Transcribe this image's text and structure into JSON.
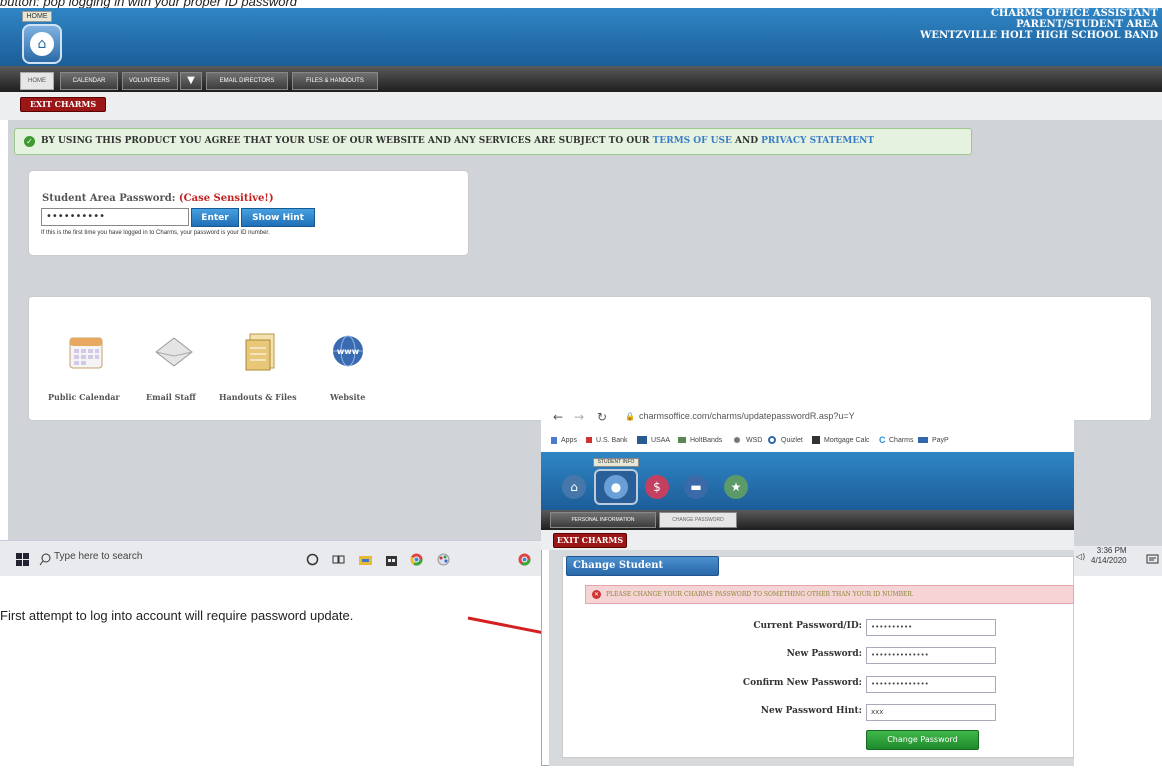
{
  "top_caption": "button: pop logging in with your proper ID password",
  "header": {
    "home_badge": "HOME",
    "right_line1": "CHARMS OFFICE ASSISTANT",
    "right_line2": "PARENT/STUDENT AREA",
    "right_line3": "WENTZVILLE HOLT HIGH SCHOOL BAND"
  },
  "nav": {
    "tabs": [
      "HOME",
      "CALENDAR",
      "VOLUNTEERS",
      "EMAIL DIRECTORS",
      "FILES & HANDOUTS"
    ]
  },
  "exit_label": "EXIT CHARMS",
  "agree": {
    "text": "BY USING THIS PRODUCT YOU AGREE THAT YOUR USE OF OUR WEBSITE AND ANY SERVICES ARE SUBJECT TO OUR",
    "link1": "TERMS OF USE",
    "and": "AND",
    "link2": "PRIVACY STATEMENT"
  },
  "login": {
    "label": "Student Area Password:",
    "case_note": "(Case Sensitive!)",
    "password_value": "••••••••••",
    "enter_label": "Enter",
    "hint_label": "Show Hint",
    "help_text": "If this is the first time you have logged in to Charms, your password is your ID number."
  },
  "icons": [
    {
      "label": "Public Calendar",
      "icon": "calendar-icon"
    },
    {
      "label": "Email Staff",
      "icon": "envelope-icon"
    },
    {
      "label": "Handouts & Files",
      "icon": "folder-icon"
    },
    {
      "label": "Website",
      "icon": "globe-icon"
    }
  ],
  "taskbar": {
    "search_placeholder": "Type here to search",
    "time": "3:36 PM",
    "date": "4/14/2020"
  },
  "caption": "First attempt to log into account will require password update.",
  "popup": {
    "url": "charmsoffice.com/charms/updatepasswordR.asp?u=Y",
    "bookmarks": [
      "Apps",
      "U.S. Bank",
      "USAA",
      "HoltBands",
      "WSD",
      "Quizlet",
      "Mortgage Calc",
      "Charms",
      "PayP"
    ],
    "student_info_badge": "STUDENT INFO",
    "tabs": [
      "PERSONAL INFORMATION",
      "CHANGE PASSWORD"
    ],
    "exit_label": "EXIT CHARMS",
    "panel_title": "Change Student Password",
    "warning": "PLEASE CHANGE YOUR CHARMS PASSWORD TO SOMETHING OTHER THAN YOUR ID NUMBER.",
    "fields": [
      {
        "label": "Current Password/ID:",
        "value": "••••••••••"
      },
      {
        "label": "New Password:",
        "value": "••••••••••••••"
      },
      {
        "label": "Confirm New Password:",
        "value": "••••••••••••••"
      },
      {
        "label": "New Password Hint:",
        "value": "xxx"
      }
    ],
    "submit_label": "Change Password"
  }
}
